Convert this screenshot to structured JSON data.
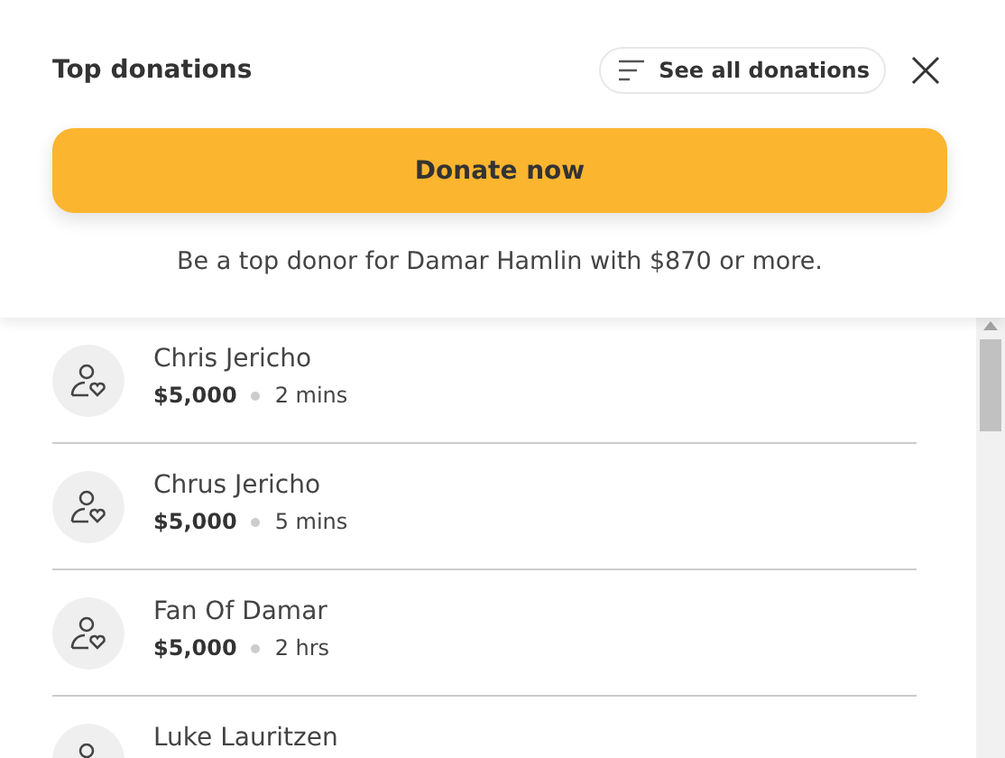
{
  "header": {
    "title": "Top donations",
    "see_all": "See all donations",
    "donate_button": "Donate now",
    "note": "Be a top donor for Damar Hamlin with $870 or more."
  },
  "donations": [
    {
      "name": "Chris Jericho",
      "amount": "$5,000",
      "time": "2 mins"
    },
    {
      "name": "Chrus Jericho",
      "amount": "$5,000",
      "time": "5 mins"
    },
    {
      "name": "Fan Of Damar",
      "amount": "$5,000",
      "time": "2 hrs"
    },
    {
      "name": "Luke Lauritzen"
    }
  ]
}
